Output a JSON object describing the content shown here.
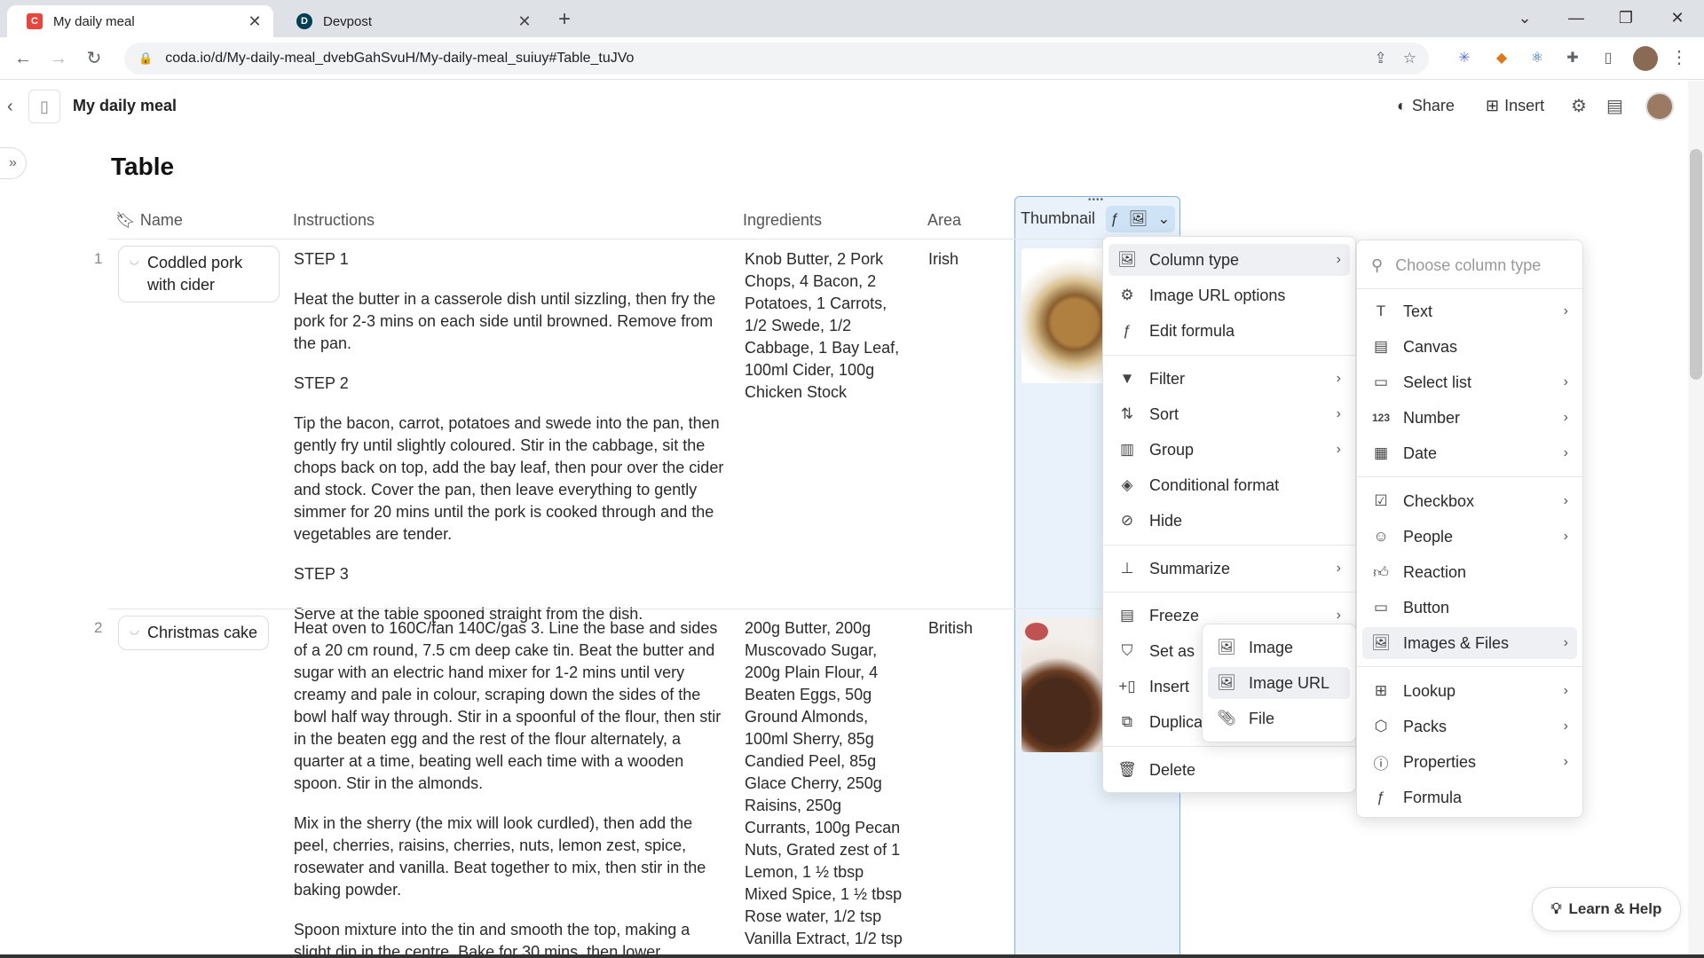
{
  "browser": {
    "tabs": [
      {
        "title": "My daily meal",
        "favicon": "coda-favicon",
        "active": true
      },
      {
        "title": "Devpost",
        "favicon": "devpost-favicon",
        "active": false
      }
    ],
    "url": "coda.io/d/My-daily-meal_dvebGahSvuH/My-daily-meal_suiuy#Table_tuJVo"
  },
  "doc": {
    "title": "My daily meal",
    "share_label": "Share",
    "insert_label": "Insert",
    "page_title": "Table"
  },
  "table": {
    "columns": [
      "Name",
      "Instructions",
      "Ingredients",
      "Area",
      "Thumbnail"
    ],
    "rows": [
      {
        "num": "1",
        "name": "Coddled pork with cider",
        "instructions": [
          "STEP 1",
          "Heat the butter in a casserole dish until sizzling, then fry the pork for 2-3 mins on each side until browned. Remove from the pan.",
          "STEP 2",
          "Tip the bacon, carrot, potatoes and swede into the pan, then gently fry until slightly coloured. Stir in the cabbage, sit the chops back on top, add the bay leaf, then pour over the cider and stock. Cover the pan, then leave everything to gently simmer for 20 mins until the pork is cooked through and the vegetables are tender.",
          "STEP 3",
          "Serve at the table spooned straight from the dish."
        ],
        "ingredients": "Knob Butter, 2 Pork Chops, 4 Bacon, 2 Potatoes, 1 Carrots, 1/2  Swede, 1/2 Cabbage, 1 Bay Leaf, 100ml Cider, 100g Chicken Stock",
        "area": "Irish"
      },
      {
        "num": "2",
        "name": "Christmas cake",
        "instructions": [
          "Heat oven to 160C/fan 140C/gas 3. Line the base and sides of a 20 cm round, 7.5 cm deep cake tin. Beat the butter and sugar with an electric hand mixer for 1-2 mins until very creamy and pale in colour, scraping down the sides of the bowl half way through. Stir in a spoonful of the flour, then stir in the beaten egg and the rest of the flour alternately, a quarter at a time, beating well each time with a wooden spoon. Stir in the almonds.",
          "Mix in the sherry (the mix will look curdled), then add the peel, cherries, raisins, cherries, nuts, lemon zest, spice, rosewater and vanilla. Beat together to mix, then stir in the baking powder.",
          "Spoon mixture into the tin and smooth the top, making a slight dip in the centre. Bake for 30 mins, then lower"
        ],
        "ingredients": "200g Butter, 200g Muscovado Sugar, 200g Plain Flour, 4 Beaten Eggs, 50g Ground Almonds, 100ml Sherry, 85g Candied Peel, 85g Glace Cherry, 250g Raisins, 250g Currants, 100g  Pecan Nuts, Grated zest of 1 Lemon, 1 ½ tbsp Mixed Spice, 1 ½ tbsp Rose water, 1/2 tsp Vanilla Extract, 1/2 tsp",
        "area": "British"
      }
    ]
  },
  "column_menu": {
    "items": [
      {
        "label": "Column type",
        "icon": "column-type-icon",
        "submenu": true
      },
      {
        "label": "Image URL options",
        "icon": "gear-icon",
        "submenu": false
      },
      {
        "label": "Edit formula",
        "icon": "formula-icon",
        "submenu": false
      },
      {
        "label": "Filter",
        "icon": "filter-icon",
        "submenu": true
      },
      {
        "label": "Sort",
        "icon": "sort-icon",
        "submenu": true
      },
      {
        "label": "Group",
        "icon": "group-icon",
        "submenu": true
      },
      {
        "label": "Conditional format",
        "icon": "paint-bucket-icon",
        "submenu": false
      },
      {
        "label": "Hide",
        "icon": "eye-off-icon",
        "submenu": false
      },
      {
        "label": "Summarize",
        "icon": "summarize-icon",
        "submenu": true
      },
      {
        "label": "Freeze",
        "icon": "freeze-icon",
        "submenu": true
      },
      {
        "label": "Set as",
        "icon": "bookmark-icon",
        "submenu": false
      },
      {
        "label": "Insert",
        "icon": "insert-icon",
        "submenu": false
      },
      {
        "label": "Duplica",
        "icon": "duplicate-icon",
        "submenu": false
      },
      {
        "label": "Delete",
        "icon": "trash-icon",
        "submenu": false
      }
    ]
  },
  "type_menu": {
    "search_placeholder": "Choose column type",
    "items": [
      {
        "label": "Text",
        "icon": "text-icon",
        "submenu": true
      },
      {
        "label": "Canvas",
        "icon": "canvas-icon",
        "submenu": false
      },
      {
        "label": "Select list",
        "icon": "select-list-icon",
        "submenu": true
      },
      {
        "label": "Number",
        "icon": "number-icon",
        "submenu": true
      },
      {
        "label": "Date",
        "icon": "calendar-icon",
        "submenu": true
      },
      {
        "label": "Checkbox",
        "icon": "checkbox-icon",
        "submenu": true
      },
      {
        "label": "People",
        "icon": "person-icon",
        "submenu": true
      },
      {
        "label": "Reaction",
        "icon": "thumbs-up-icon",
        "submenu": false
      },
      {
        "label": "Button",
        "icon": "button-icon",
        "submenu": false
      },
      {
        "label": "Images & Files",
        "icon": "image-icon",
        "submenu": true
      },
      {
        "label": "Lookup",
        "icon": "table-icon",
        "submenu": true
      },
      {
        "label": "Packs",
        "icon": "packs-icon",
        "submenu": true
      },
      {
        "label": "Properties",
        "icon": "info-icon",
        "submenu": true
      },
      {
        "label": "Formula",
        "icon": "formula-icon",
        "submenu": false
      }
    ]
  },
  "image_menu": {
    "items": [
      {
        "label": "Image",
        "icon": "image-icon"
      },
      {
        "label": "Image URL",
        "icon": "image-url-icon"
      },
      {
        "label": "File",
        "icon": "paperclip-icon"
      }
    ]
  },
  "help": {
    "label": "Learn & Help"
  }
}
